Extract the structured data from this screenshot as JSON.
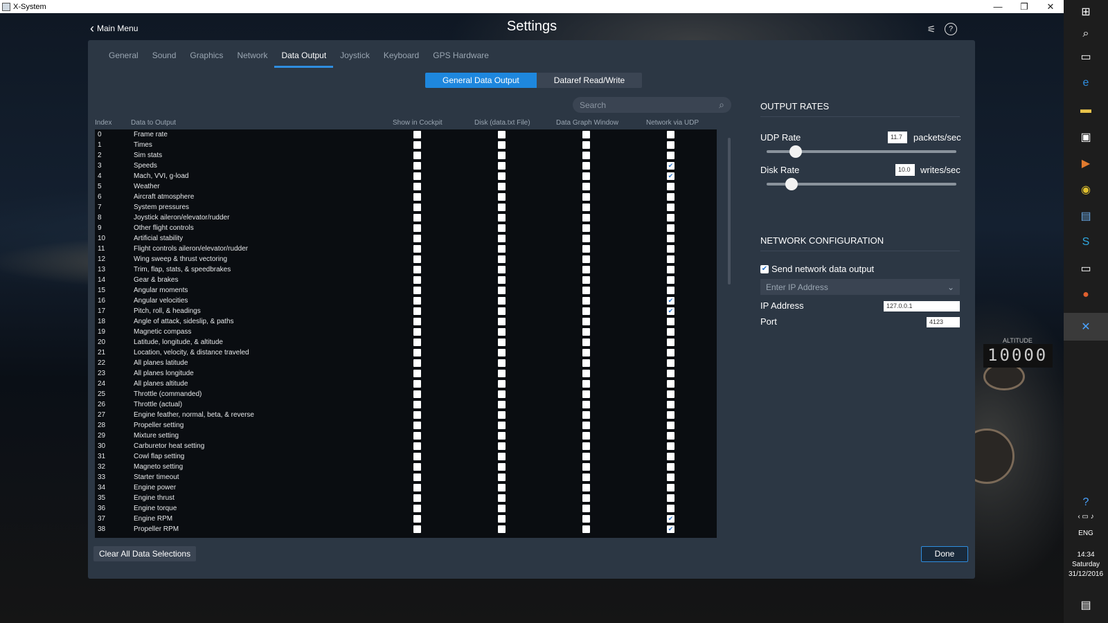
{
  "window": {
    "title": "X-System",
    "minimize": "—",
    "maximize": "❐",
    "close": "✕"
  },
  "header": {
    "back_label": "Main Menu",
    "title": "Settings"
  },
  "tabs": [
    {
      "label": "General"
    },
    {
      "label": "Sound"
    },
    {
      "label": "Graphics"
    },
    {
      "label": "Network"
    },
    {
      "label": "Data Output",
      "active": true
    },
    {
      "label": "Joystick"
    },
    {
      "label": "Keyboard"
    },
    {
      "label": "GPS Hardware"
    }
  ],
  "segments": [
    {
      "label": "General Data Output",
      "active": true
    },
    {
      "label": "Dataref Read/Write"
    }
  ],
  "search": {
    "placeholder": "Search"
  },
  "columns": {
    "index": "Index",
    "data": "Data to Output",
    "cockpit": "Show in Cockpit",
    "disk": "Disk (data.txt File)",
    "graph": "Data Graph Window",
    "udp": "Network via UDP"
  },
  "rows": [
    {
      "index": "0",
      "name": "Frame rate",
      "udp": false
    },
    {
      "index": "1",
      "name": "Times",
      "udp": false
    },
    {
      "index": "2",
      "name": "Sim stats",
      "udp": false
    },
    {
      "index": "3",
      "name": "Speeds",
      "udp": true
    },
    {
      "index": "4",
      "name": "Mach, VVI, g-load",
      "udp": true
    },
    {
      "index": "5",
      "name": "Weather",
      "udp": false
    },
    {
      "index": "6",
      "name": "Aircraft atmosphere",
      "udp": false
    },
    {
      "index": "7",
      "name": "System pressures",
      "udp": false
    },
    {
      "index": "8",
      "name": "Joystick aileron/elevator/rudder",
      "udp": false
    },
    {
      "index": "9",
      "name": "Other flight controls",
      "udp": false
    },
    {
      "index": "10",
      "name": "Artificial stability",
      "udp": false
    },
    {
      "index": "11",
      "name": "Flight controls aileron/elevator/rudder",
      "udp": false
    },
    {
      "index": "12",
      "name": "Wing sweep & thrust vectoring",
      "udp": false
    },
    {
      "index": "13",
      "name": "Trim, flap, stats, & speedbrakes",
      "udp": false
    },
    {
      "index": "14",
      "name": "Gear & brakes",
      "udp": false
    },
    {
      "index": "15",
      "name": "Angular moments",
      "udp": false
    },
    {
      "index": "16",
      "name": "Angular velocities",
      "udp": true
    },
    {
      "index": "17",
      "name": "Pitch, roll, & headings",
      "udp": true
    },
    {
      "index": "18",
      "name": "Angle of attack, sideslip, & paths",
      "udp": false
    },
    {
      "index": "19",
      "name": "Magnetic compass",
      "udp": false
    },
    {
      "index": "20",
      "name": "Latitude, longitude, & altitude",
      "udp": false
    },
    {
      "index": "21",
      "name": "Location, velocity, & distance traveled",
      "udp": false
    },
    {
      "index": "22",
      "name": "All planes latitude",
      "udp": false
    },
    {
      "index": "23",
      "name": "All planes longitude",
      "udp": false
    },
    {
      "index": "24",
      "name": "All planes altitude",
      "udp": false
    },
    {
      "index": "25",
      "name": "Throttle (commanded)",
      "udp": false
    },
    {
      "index": "26",
      "name": "Throttle (actual)",
      "udp": false
    },
    {
      "index": "27",
      "name": "Engine feather, normal, beta, & reverse",
      "udp": false
    },
    {
      "index": "28",
      "name": "Propeller setting",
      "udp": false
    },
    {
      "index": "29",
      "name": "Mixture setting",
      "udp": false
    },
    {
      "index": "30",
      "name": "Carburetor heat setting",
      "udp": false
    },
    {
      "index": "31",
      "name": "Cowl flap setting",
      "udp": false
    },
    {
      "index": "32",
      "name": "Magneto setting",
      "udp": false
    },
    {
      "index": "33",
      "name": "Starter timeout",
      "udp": false
    },
    {
      "index": "34",
      "name": "Engine power",
      "udp": false
    },
    {
      "index": "35",
      "name": "Engine thrust",
      "udp": false
    },
    {
      "index": "36",
      "name": "Engine torque",
      "udp": false
    },
    {
      "index": "37",
      "name": "Engine RPM",
      "udp": true
    },
    {
      "index": "38",
      "name": "Propeller RPM",
      "udp": true
    }
  ],
  "output_rates": {
    "title": "OUTPUT RATES",
    "udp": {
      "label": "UDP Rate",
      "value": "11.7",
      "unit": "packets/sec",
      "slider_fraction": 0.12
    },
    "disk": {
      "label": "Disk Rate",
      "value": "10.0",
      "unit": "writes/sec",
      "slider_fraction": 0.1
    }
  },
  "network": {
    "title": "NETWORK CONFIGURATION",
    "send_label": "Send network data output",
    "send_checked": true,
    "ip_select_placeholder": "Enter IP Address",
    "ip_label": "IP Address",
    "ip_value": "127.0.0.1",
    "port_label": "Port",
    "port_value": "4123"
  },
  "footer": {
    "clear_label": "Clear All Data Selections",
    "done_label": "Done"
  },
  "taskbar": {
    "lang": "ENG",
    "time": "14:34",
    "day": "Saturday",
    "date": "31/12/2016"
  },
  "colors": {
    "accent": "#1e87de",
    "panel": "#2c3744",
    "table_bg": "#0a0d11"
  }
}
